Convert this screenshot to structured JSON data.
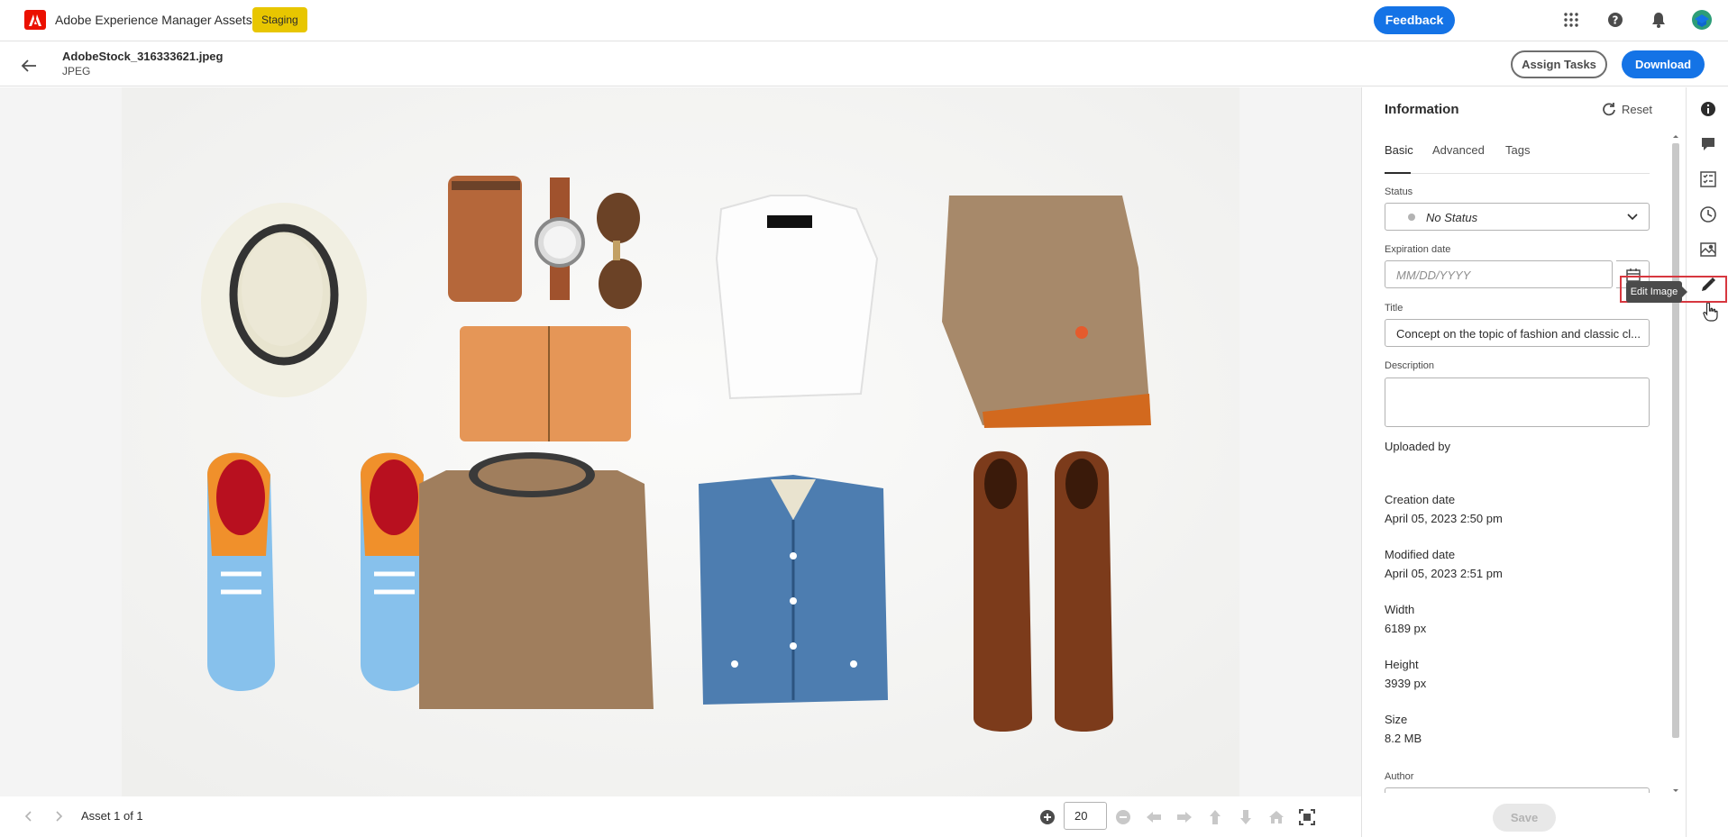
{
  "header": {
    "app_title": "Adobe Experience Manager Assets",
    "environment_badge": "Staging",
    "feedback_label": "Feedback",
    "icons": [
      "apps-grid-icon",
      "help-icon",
      "notifications-bell-icon",
      "user-avatar"
    ]
  },
  "asset_bar": {
    "file_name": "AdobeStock_316333621.jpeg",
    "file_type": "JPEG",
    "assign_tasks_label": "Assign Tasks",
    "download_label": "Download"
  },
  "footer": {
    "asset_position": "Asset 1 of 1",
    "zoom_value": "20"
  },
  "panel": {
    "title": "Information",
    "reset_label": "Reset",
    "tabs": [
      {
        "label": "Basic",
        "active": true
      },
      {
        "label": "Advanced",
        "active": false
      },
      {
        "label": "Tags",
        "active": false
      }
    ],
    "status_label": "Status",
    "status_value": "No Status",
    "expiration_label": "Expiration date",
    "expiration_placeholder": "MM/DD/YYYY",
    "title_label": "Title",
    "title_value": "Concept on the topic of fashion and classic cl...",
    "description_label": "Description",
    "description_value": "",
    "uploaded_by_label": "Uploaded by",
    "creation_date_label": "Creation date",
    "creation_date_value": "April 05, 2023 2:50 pm",
    "modified_date_label": "Modified date",
    "modified_date_value": "April 05, 2023 2:51 pm",
    "width_label": "Width",
    "width_value": "6189 px",
    "height_label": "Height",
    "height_value": "3939 px",
    "size_label": "Size",
    "size_value": "8.2 MB",
    "author_label": "Author",
    "save_label": "Save"
  },
  "rail": {
    "tooltip": "Edit Image",
    "icons": [
      "info-icon",
      "comments-icon",
      "tasks-icon",
      "history-icon",
      "renditions-icon",
      "edit-image-icon"
    ]
  },
  "colors": {
    "accent": "#1473e6",
    "badge": "#e8c600",
    "brand": "#eb1000",
    "highlight": "#d7373f"
  }
}
